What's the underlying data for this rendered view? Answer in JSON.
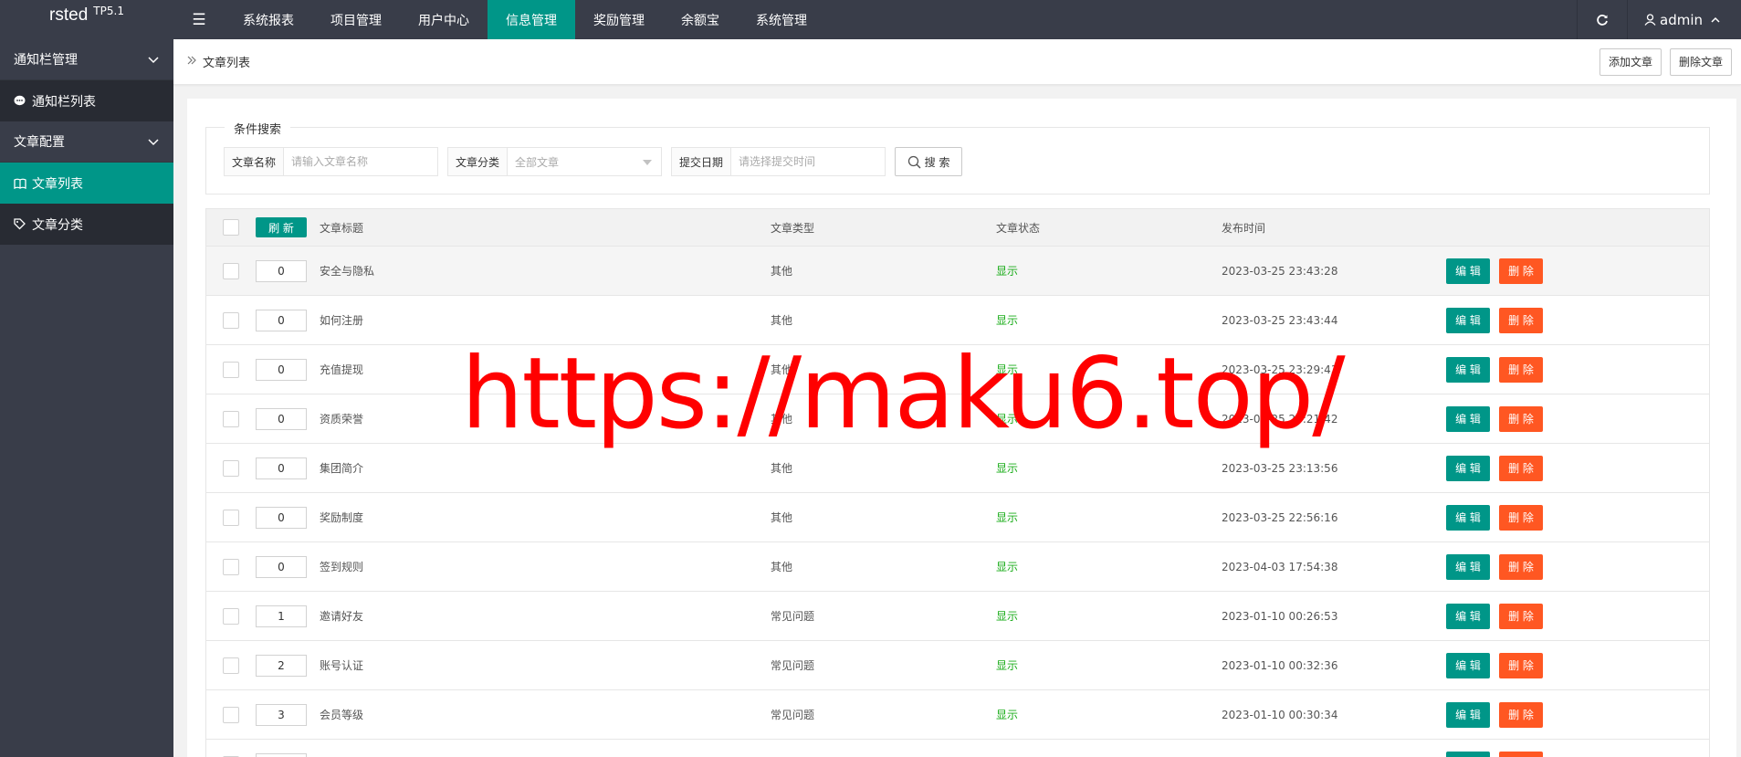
{
  "header": {
    "logo": "rsted",
    "version": "TP5.1",
    "menu_icon": "☰",
    "nav": [
      {
        "label": "系统报表"
      },
      {
        "label": "项目管理"
      },
      {
        "label": "用户中心"
      },
      {
        "label": "信息管理",
        "active": true
      },
      {
        "label": "奖励管理"
      },
      {
        "label": "余额宝"
      },
      {
        "label": "系统管理"
      }
    ],
    "user": "admin"
  },
  "sidebar": {
    "groups": [
      {
        "label": "通知栏管理",
        "items": [
          {
            "label": "通知栏列表",
            "icon": "chat-icon"
          }
        ]
      },
      {
        "label": "文章配置",
        "items": [
          {
            "label": "文章列表",
            "icon": "book-icon",
            "active": true
          },
          {
            "label": "文章分类",
            "icon": "tag-icon"
          }
        ]
      }
    ]
  },
  "breadcrumb": "文章列表",
  "actions": {
    "add": "添加文章",
    "delete": "删除文章"
  },
  "search": {
    "legend": "条件搜索",
    "name_label": "文章名称",
    "name_placeholder": "请输入文章名称",
    "category_label": "文章分类",
    "category_value": "全部文章",
    "date_label": "提交日期",
    "date_placeholder": "请选择提交时间",
    "button": "搜 索"
  },
  "table": {
    "refresh": "刷 新",
    "headers": {
      "title": "文章标题",
      "type": "文章类型",
      "status": "文章状态",
      "date": "发布时间"
    },
    "edit_label": "编 辑",
    "delete_label": "删 除",
    "rows": [
      {
        "sort": "0",
        "title": "安全与隐私",
        "type": "其他",
        "status": "显示",
        "date": "2023-03-25 23:43:28"
      },
      {
        "sort": "0",
        "title": "如何注册",
        "type": "其他",
        "status": "显示",
        "date": "2023-03-25 23:43:44"
      },
      {
        "sort": "0",
        "title": "充值提现",
        "type": "其他",
        "status": "显示",
        "date": "2023-03-25 23:29:43"
      },
      {
        "sort": "0",
        "title": "资质荣誉",
        "type": "其他",
        "status": "显示",
        "date": "2023-03-25 23:21:42"
      },
      {
        "sort": "0",
        "title": "集团简介",
        "type": "其他",
        "status": "显示",
        "date": "2023-03-25 23:13:56"
      },
      {
        "sort": "0",
        "title": "奖励制度",
        "type": "其他",
        "status": "显示",
        "date": "2023-03-25 22:56:16"
      },
      {
        "sort": "0",
        "title": "签到规则",
        "type": "其他",
        "status": "显示",
        "date": "2023-04-03 17:54:38"
      },
      {
        "sort": "1",
        "title": "邀请好友",
        "type": "常见问题",
        "status": "显示",
        "date": "2023-01-10 00:26:53"
      },
      {
        "sort": "2",
        "title": "账号认证",
        "type": "常见问题",
        "status": "显示",
        "date": "2023-01-10 00:32:36"
      },
      {
        "sort": "3",
        "title": "会员等级",
        "type": "常见问题",
        "status": "显示",
        "date": "2023-01-10 00:30:34"
      },
      {
        "sort": "",
        "title": "",
        "type": "",
        "status": "",
        "date": ""
      }
    ]
  },
  "watermark": "https://maku6.top/",
  "colors": {
    "primary": "#009688",
    "danger": "#ff5722",
    "status_green": "#1aac19",
    "watermark": "#ff0000"
  }
}
